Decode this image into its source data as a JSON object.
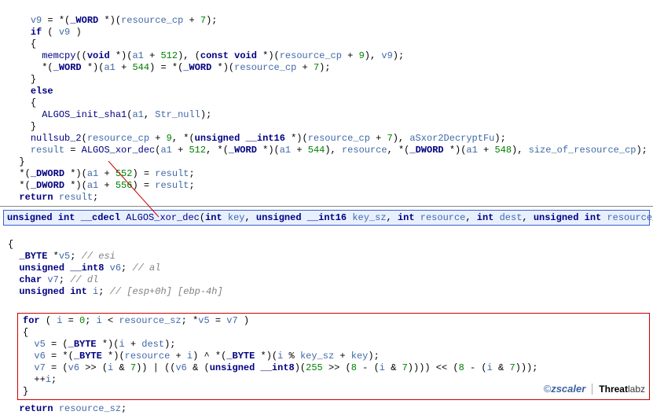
{
  "top": {
    "l1": "    v9 = *(_WORD *)(resource_cp + 7);",
    "l2": "    if ( v9 )",
    "l3": "    {",
    "l4": "      memcpy((void *)(a1 + 512), (const void *)(resource_cp + 9), v9);",
    "l5": "      *(_WORD *)(a1 + 544) = *(_WORD *)(resource_cp + 7);",
    "l6": "    }",
    "l7": "    else",
    "l8": "    {",
    "l9": "      ALGOS_init_sha1(a1, Str_null);",
    "l10": "    }",
    "l11": "    nullsub_2(resource_cp + 9, *(unsigned __int16 *)(resource_cp + 7), aSxor2DecryptFu);",
    "l12": "    result = ALGOS_xor_dec(a1 + 512, *(_WORD *)(a1 + 544), resource, *(_DWORD *)(a1 + 548), size_of_resource_cp);",
    "l13": "  }",
    "l14": "  *(_DWORD *)(a1 + 552) = result;",
    "l15": "  *(_DWORD *)(a1 + 556) = result;",
    "l16": "  return result;"
  },
  "sig": "unsigned int __cdecl ALGOS_xor_dec(int key, unsigned __int16 key_sz, int resource, int dest, unsigned int resource_sz)",
  "mid": {
    "l1": "{",
    "l2": "  _BYTE *v5; // esi",
    "l3": "  unsigned __int8 v6; // al",
    "l4": "  char v7; // dl",
    "l5": "  unsigned int i; // [esp+0h] [ebp-4h]",
    "l6": ""
  },
  "box": {
    "l1": "for ( i = 0; i < resource_sz; *v5 = v7 )",
    "l2": "{",
    "l3": "  v5 = (_BYTE *)(i + dest);",
    "l4": "  v6 = *(_BYTE *)(resource + i) ^ *(_BYTE *)(i % key_sz + key);",
    "l5": "  v7 = (v6 >> (i & 7)) | ((v6 & (unsigned __int8)(255 >> (8 - (i & 7)))) << (8 - (i & 7)));",
    "l6": "  ++i;",
    "l7": "}"
  },
  "after": {
    "l1": "  return resource_sz;"
  },
  "footer": {
    "zscaler": "zscaler",
    "threat": "Threat",
    "labz": "labz"
  }
}
